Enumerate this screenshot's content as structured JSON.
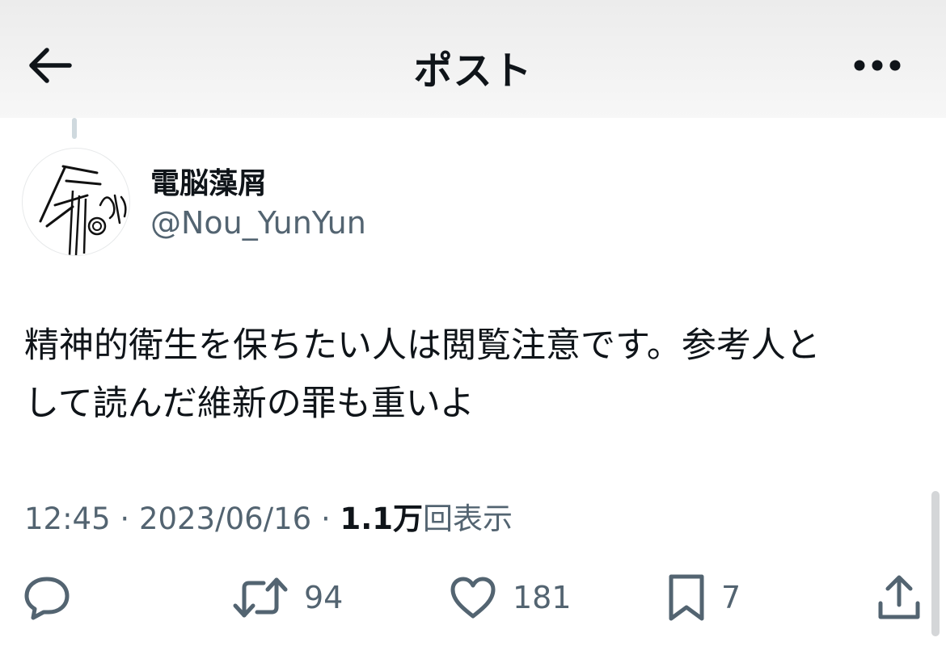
{
  "header": {
    "title": "ポスト",
    "back_icon": "arrow-left-icon",
    "more_icon": "more-horizontal-icon"
  },
  "author": {
    "display_name": "電脳藻屑",
    "handle": "@Nou_YunYun"
  },
  "tweet": {
    "text_line1": "精神的衛生を保ちたい人は閲覧注意です。参考人と",
    "text_line2": "して読んだ維新の罪も重いよ",
    "time": "12:45",
    "separator": "·",
    "date": "2023/06/16",
    "views_count": "1.1万",
    "views_label": "回表示"
  },
  "actions": {
    "reply_icon": "reply-icon",
    "retweet_icon": "retweet-icon",
    "retweet_count": "94",
    "like_icon": "heart-icon",
    "like_count": "181",
    "bookmark_icon": "bookmark-icon",
    "bookmark_count": "7",
    "share_icon": "share-icon"
  },
  "colors": {
    "text_primary": "#0f1419",
    "text_secondary": "#536471",
    "header_bg": "#f0f0f0"
  }
}
